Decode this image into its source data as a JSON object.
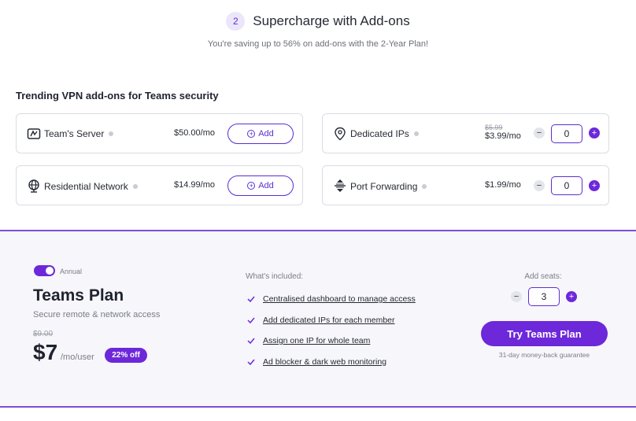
{
  "header": {
    "step_number": "2",
    "title": "Supercharge with Add-ons",
    "subtitle": "You're saving up to 56% on add-ons with the 2-Year Plan!"
  },
  "addons": {
    "section_title": "Trending VPN add-ons for Teams security",
    "add_label": "Add",
    "teams_server": {
      "name": "Team's Server",
      "price": "$50.00/mo",
      "icon": "server-icon"
    },
    "residential_network": {
      "name": "Residential Network",
      "price": "$14.99/mo",
      "icon": "globe-icon"
    },
    "dedicated_ips": {
      "name": "Dedicated IPs",
      "old_price": "$5.99",
      "price": "$3.99/mo",
      "quantity": "0",
      "icon": "location-pin-icon"
    },
    "port_forwarding": {
      "name": "Port Forwarding",
      "price": "$1.99/mo",
      "quantity": "0",
      "icon": "arrows-up-down-icon"
    }
  },
  "plan": {
    "billing_toggle_label": "Annual",
    "billing_toggle_on": true,
    "name": "Teams Plan",
    "description": "Secure remote & network access",
    "old_price": "$9.00",
    "price": "$7",
    "unit": "/mo/user",
    "discount": "22% off",
    "included_title": "What's included:",
    "included": [
      "Centralised dashboard to manage access",
      "Add dedicated IPs for each member",
      "Assign one IP for whole team",
      "Ad blocker & dark web monitoring"
    ],
    "seats_label": "Add seats:",
    "seats": "3",
    "cta": "Try Teams Plan",
    "guarantee": "31-day money-back guarantee"
  },
  "colors": {
    "accent": "#6d28d9",
    "band_background": "#f7f6fb",
    "border": "#d9dce3"
  }
}
